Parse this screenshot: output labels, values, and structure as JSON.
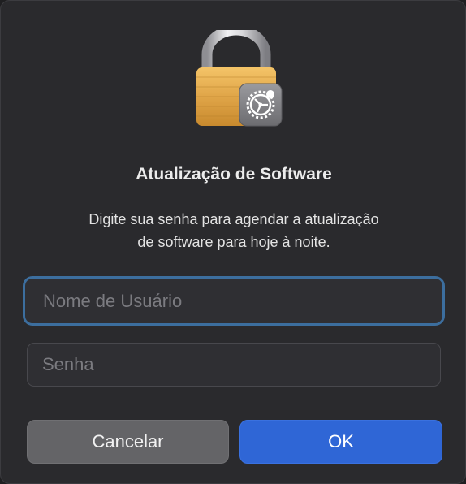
{
  "dialog": {
    "title": "Atualização de Software",
    "message_line1": "Digite sua senha para agendar a atualização",
    "message_line2": "de software para hoje à noite.",
    "icon": "lock-with-gear-icon",
    "username_field": {
      "placeholder": "Nome de Usuário",
      "value": ""
    },
    "password_field": {
      "placeholder": "Senha",
      "value": ""
    },
    "cancel_label": "Cancelar",
    "ok_label": "OK"
  },
  "colors": {
    "background": "#2a2a2d",
    "accent": "#2f66d6",
    "focus_ring": "#3c6e9e",
    "cancel_button": "#646467"
  }
}
